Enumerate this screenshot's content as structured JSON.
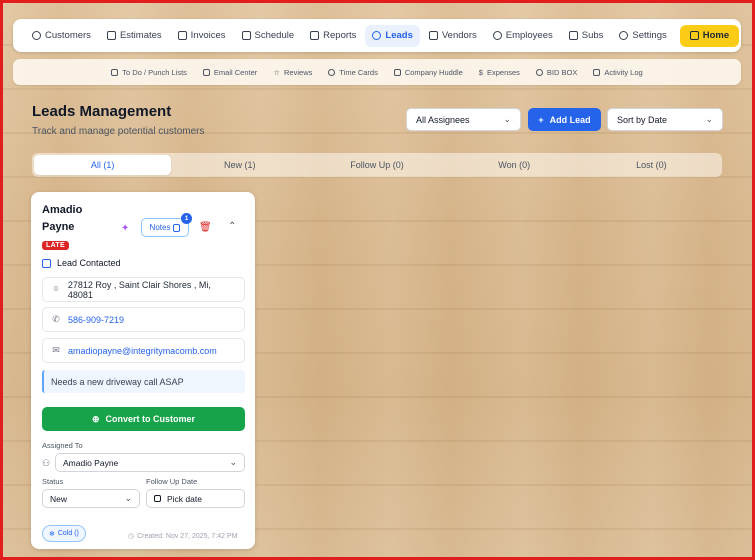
{
  "nav": {
    "items": [
      {
        "label": "Customers",
        "icon": "users-icon",
        "active": false
      },
      {
        "label": "Estimates",
        "icon": "file-icon",
        "active": false
      },
      {
        "label": "Invoices",
        "icon": "receipt-icon",
        "active": false
      },
      {
        "label": "Schedule",
        "icon": "calendar-icon",
        "active": false
      },
      {
        "label": "Reports",
        "icon": "bar-chart-icon",
        "active": false
      },
      {
        "label": "Leads",
        "icon": "target-icon",
        "active": true
      },
      {
        "label": "Vendors",
        "icon": "store-icon",
        "active": false
      },
      {
        "label": "Employees",
        "icon": "user-plus-icon",
        "active": false
      },
      {
        "label": "Subs",
        "icon": "wrench-icon",
        "active": false
      },
      {
        "label": "Settings",
        "icon": "gear-icon",
        "active": false
      }
    ],
    "home_label": "Home",
    "accent": "#2563eb",
    "home_color": "#facc15"
  },
  "subnav": {
    "items": [
      {
        "label": "To Do / Punch Lists",
        "icon": "clipboard-icon"
      },
      {
        "label": "Email Center",
        "icon": "mail-icon"
      },
      {
        "label": "Reviews",
        "icon": "star-icon"
      },
      {
        "label": "Time Cards",
        "icon": "clock-icon"
      },
      {
        "label": "Company Huddle",
        "icon": "chat-icon"
      },
      {
        "label": "Expenses",
        "icon": "dollar-icon"
      },
      {
        "label": "BID BOX",
        "icon": "eye-icon"
      },
      {
        "label": "Activity Log",
        "icon": "log-icon"
      }
    ]
  },
  "header": {
    "title": "Leads Management",
    "subtitle": "Track and manage potential customers",
    "assignee_filter": "All Assignees",
    "add_lead_label": "Add Lead",
    "sort_label": "Sort by Date"
  },
  "tabs": [
    {
      "label": "All (1)",
      "active": true
    },
    {
      "label": "New (1)",
      "active": false
    },
    {
      "label": "Follow Up (0)",
      "active": false
    },
    {
      "label": "Won (0)",
      "active": false
    },
    {
      "label": "Lost (0)",
      "active": false
    }
  ],
  "lead": {
    "first_name": "Amadio",
    "last_name": "Payne",
    "notes_label": "Notes",
    "notes_count": "1",
    "status_badge": "LATE",
    "contacted_label": "Lead Contacted",
    "address": "27812 Roy , Saint Clair Shores , Mi, 48081",
    "phone": "586-909-7219",
    "email": "amadiopayne@integritymacomb.com",
    "note": "Needs a new driveway call ASAP",
    "convert_label": "Convert to Customer",
    "assigned_to_label": "Assigned To",
    "assigned_to": "Amadio Payne",
    "status_label": "Status",
    "status_value": "New",
    "follow_up_label": "Follow Up Date",
    "follow_up_placeholder": "Pick date",
    "temperature": "Cold ()",
    "created": "Created: Nov 27, 2025, 7:42 PM"
  }
}
